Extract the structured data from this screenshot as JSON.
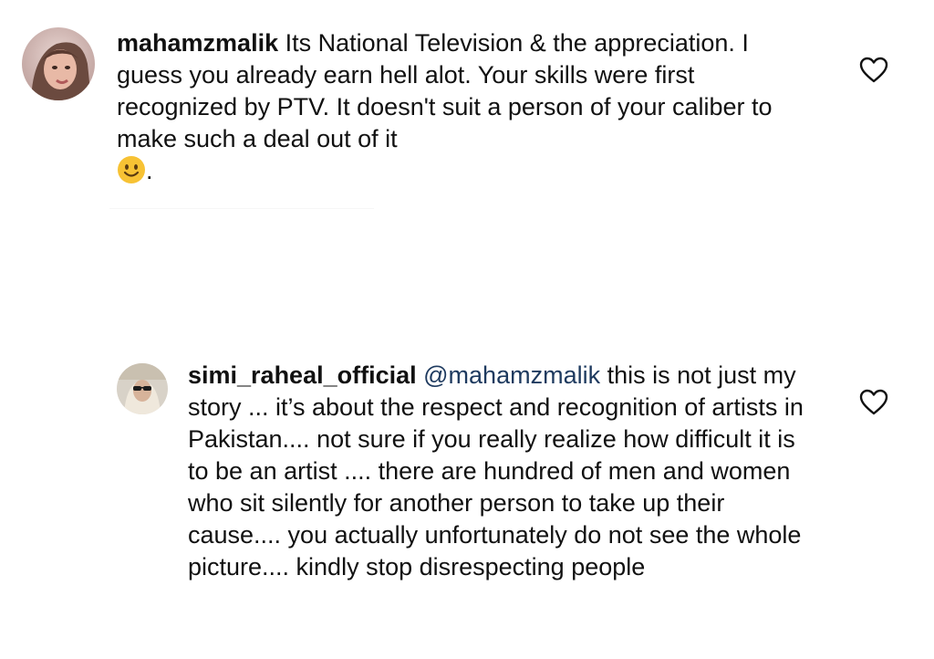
{
  "comments": [
    {
      "username": "mahamzmalik",
      "text": "Its National Television & the appreciation. I guess you already earn hell alot. Your skills were first recognized by PTV. It doesn't suit a person of your caliber to make such a deal out of it",
      "after_emoji": ".",
      "emoji": "slightly-smiling-face",
      "like_icon": "heart-outline-icon"
    },
    {
      "username": "simi_raheal_official",
      "mention": "@mahamzmalik",
      "text": "this is not just my story ... it’s about the respect and recognition of artists in Pakistan.... not sure if you really realize how difficult it is to be an artist .... there are hundred of men and women who sit silently for another person to take up their cause.... you actually unfortunately do not see the whole picture.... kindly stop disrespecting people",
      "like_icon": "heart-outline-icon"
    }
  ],
  "colors": {
    "text": "#111111",
    "mention": "#1e3a5f",
    "heart_outline": "#111111",
    "emoji_face": "#f7c234"
  }
}
